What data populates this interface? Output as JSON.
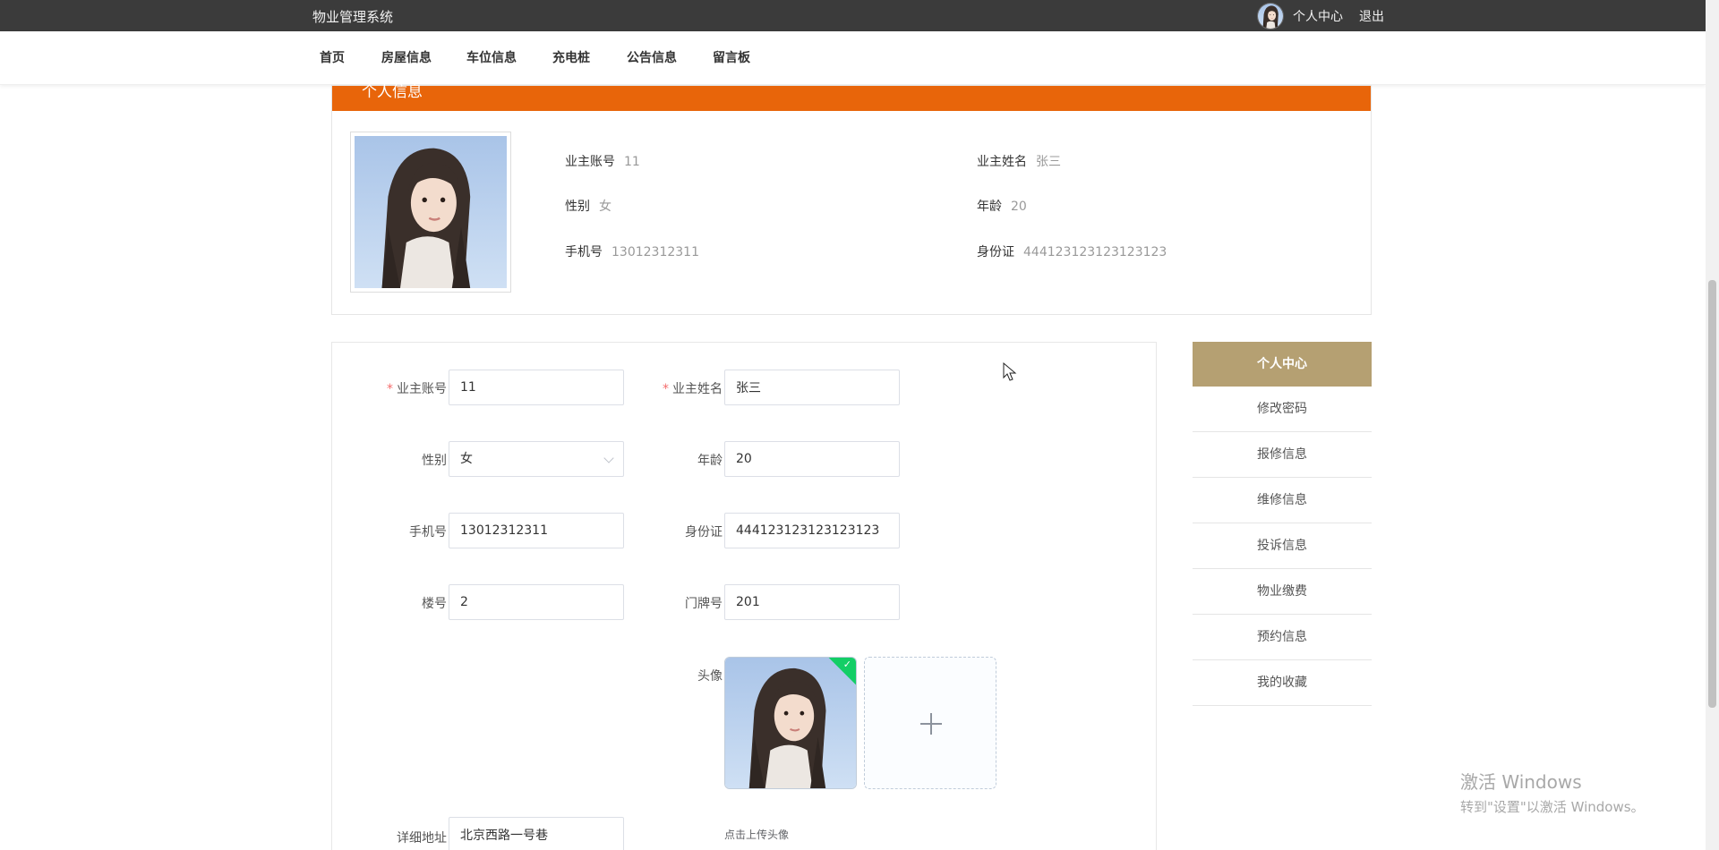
{
  "app": {
    "title": "物业管理系统"
  },
  "topbar": {
    "profile_label": "个人中心",
    "logout_label": "退出"
  },
  "nav": {
    "items": [
      {
        "label": "首页"
      },
      {
        "label": "房屋信息"
      },
      {
        "label": "车位信息"
      },
      {
        "label": "充电桩"
      },
      {
        "label": "公告信息"
      },
      {
        "label": "留言板"
      }
    ]
  },
  "info_card": {
    "title": "个人信息",
    "fields": [
      {
        "label": "业主账号",
        "value": "11"
      },
      {
        "label": "业主姓名",
        "value": "张三"
      },
      {
        "label": "性别",
        "value": "女"
      },
      {
        "label": "年龄",
        "value": "20"
      },
      {
        "label": "手机号",
        "value": "13012312311"
      },
      {
        "label": "身份证",
        "value": "444123123123123123"
      }
    ]
  },
  "form": {
    "account": {
      "label": "业主账号",
      "value": "11",
      "required": true
    },
    "name": {
      "label": "业主姓名",
      "value": "张三",
      "required": true
    },
    "gender": {
      "label": "性别",
      "value": "女"
    },
    "age": {
      "label": "年龄",
      "value": "20"
    },
    "phone": {
      "label": "手机号",
      "value": "13012312311"
    },
    "id_card": {
      "label": "身份证",
      "value": "444123123123123123"
    },
    "building": {
      "label": "楼号",
      "value": "2"
    },
    "door": {
      "label": "门牌号",
      "value": "201"
    },
    "avatar": {
      "label": "头像",
      "hint": "点击上传头像"
    },
    "address": {
      "label": "详细地址",
      "value": "北京西路一号巷"
    },
    "required_mark": "*"
  },
  "side_menu": {
    "active": "个人中心",
    "items": [
      "修改密码",
      "报修信息",
      "维修信息",
      "投诉信息",
      "物业缴费",
      "预约信息",
      "我的收藏"
    ]
  },
  "watermark": {
    "line1": "激活 Windows",
    "line2": "转到\"设置\"以激活 Windows。"
  },
  "colors": {
    "topbar": "#3b3b3b",
    "header_orange": "#e8650a",
    "menu_active": "#b5a072",
    "success": "#13ce66"
  }
}
